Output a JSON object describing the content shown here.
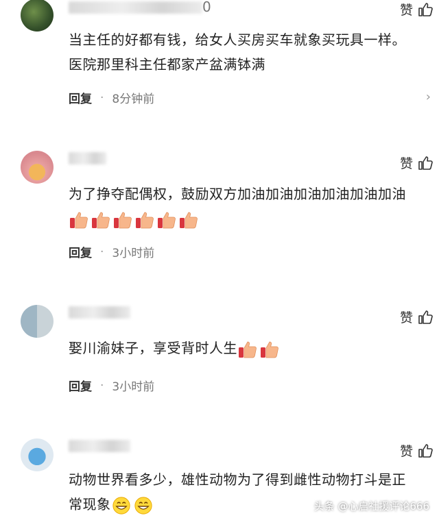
{
  "like_label": "赞",
  "reply_label": "回复",
  "dot": "·",
  "watermark": "头条 @心启社援评论666",
  "comments": [
    {
      "name_suffix": "0",
      "text": "当主任的好都有钱，给女人买房买车就象买玩具一样。医院那里科主任都家产盆满钵满",
      "time": "8分钟前"
    },
    {
      "text": "为了挣夺配偶权，鼓励双方加油加油加油加油加油加油",
      "emoji_name": "thumbs-up-emoji",
      "emoji_count": 6,
      "time": "3小时前"
    },
    {
      "text": "娶川渝妹子，享受背时人生",
      "emoji_name": "thumbs-up-emoji",
      "emoji_count": 2,
      "time": "3小时前"
    },
    {
      "text": "动物世界看多少，雄性动物为了得到雌性动物打斗是正常现象",
      "emoji_name": "grin-emoji",
      "emoji_count": 2
    }
  ]
}
